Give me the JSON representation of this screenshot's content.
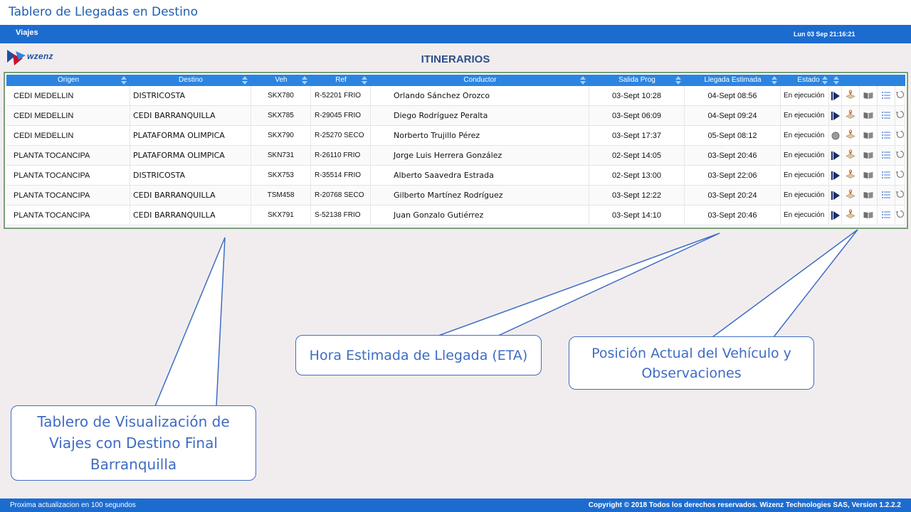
{
  "page_title": "Tablero de Llegadas en Destino",
  "nav": {
    "viajes": "Viajes",
    "datetime": "Lun 03 Sep 21:16:21"
  },
  "logo_text": "wzenz",
  "section_title": "ITINERARIOS",
  "table": {
    "headers": [
      "Origen",
      "Destino",
      "Veh",
      "Ref",
      "Conductor",
      "Salida Prog",
      "Llegada Estimada",
      "Estado"
    ],
    "rows": [
      {
        "origen": "CEDI MEDELLIN",
        "destino": "DISTRICOSTA",
        "veh": "SKX780",
        "ref": "R-52201 FRIO",
        "conductor": "Orlando Sánchez Orozco",
        "salida": "03-Sept 10:28",
        "llegada": "04-Sept 08:56",
        "estado": "En ejecución",
        "state_icon": "play-icon"
      },
      {
        "origen": "CEDI MEDELLIN",
        "destino": "CEDI BARRANQUILLA",
        "veh": "SKX785",
        "ref": "R-29045 FRIO",
        "conductor": "Diego Rodríguez Peralta",
        "salida": "03-Sept 06:09",
        "llegada": "04-Sept 09:24",
        "estado": "En ejecución",
        "state_icon": "play-icon"
      },
      {
        "origen": "CEDI MEDELLIN",
        "destino": "PLATAFORMA OLIMPICA",
        "veh": "SKX790",
        "ref": "R-25270 SECO",
        "conductor": "Norberto Trujillo Pérez",
        "salida": "03-Sept 17:37",
        "llegada": "05-Sept 08:12",
        "estado": "En ejecución",
        "state_icon": "stop-icon"
      },
      {
        "origen": "PLANTA TOCANCIPA",
        "destino": "PLATAFORMA OLIMPICA",
        "veh": "SKN731",
        "ref": "R-26110 FRIO",
        "conductor": "Jorge Luis Herrera González",
        "salida": "02-Sept 14:05",
        "llegada": "03-Sept 20:46",
        "estado": "En ejecución",
        "state_icon": "play-icon"
      },
      {
        "origen": "PLANTA TOCANCIPA",
        "destino": "DISTRICOSTA",
        "veh": "SKX753",
        "ref": "R-35514 FRIO",
        "conductor": "Alberto Saavedra Estrada",
        "salida": "02-Sept 13:00",
        "llegada": "03-Sept 22:06",
        "estado": "En ejecución",
        "state_icon": "play-icon"
      },
      {
        "origen": "PLANTA TOCANCIPA",
        "destino": "CEDI BARRANQUILLA",
        "veh": "TSM458",
        "ref": "R-20768 SECO",
        "conductor": "Gilberto Martínez Rodríguez",
        "salida": "03-Sept 12:22",
        "llegada": "03-Sept 20:24",
        "estado": "En ejecución",
        "state_icon": "play-icon"
      },
      {
        "origen": "PLANTA TOCANCIPA",
        "destino": "CEDI BARRANQUILLA",
        "veh": "SKX791",
        "ref": "S-52138 FRIO",
        "conductor": "Juan Gonzalo Gutiérrez",
        "salida": "03-Sept 14:10",
        "llegada": "03-Sept 20:46",
        "estado": "En ejecución",
        "state_icon": "play-icon"
      }
    ],
    "row_action_icons": [
      "map-pin-icon",
      "book-icon",
      "list-icon",
      "refresh-icon"
    ]
  },
  "callouts": {
    "eta": "Hora Estimada de Llegada (ETA)",
    "position": [
      "Posición Actual del Vehículo y",
      "Observaciones"
    ],
    "board": [
      "Tablero de Visualización de",
      "Viajes con Destino Final",
      "Barranquilla"
    ]
  },
  "footer": {
    "refresh": "Proxima actualizacion en 100 segundos",
    "copyright": "Copyright © 2018 Todos los derechos reservados. Wizenz Technologies SAS, Version 1.2.2.2"
  },
  "colors": {
    "nav_blue": "#1c6cd0",
    "header_blue": "#2b85e0",
    "callout_blue": "#3f6cc4",
    "background": "#f1edee"
  }
}
